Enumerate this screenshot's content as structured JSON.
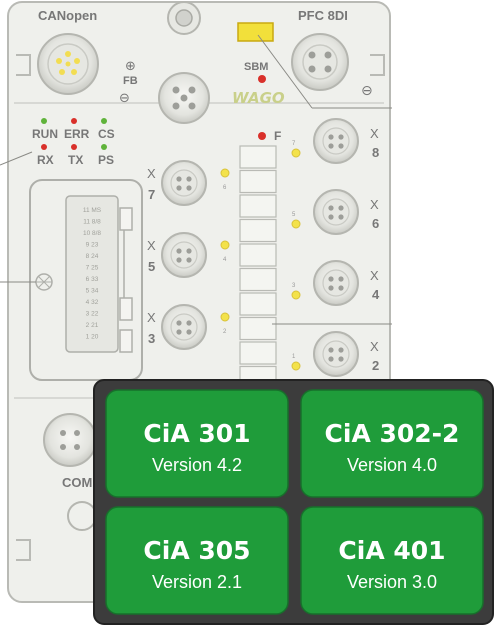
{
  "device": {
    "left_top_label": "CANopen",
    "right_top_label": "PFC 8DI",
    "fb_label": "FB",
    "sbm_label": "SBM",
    "brand": "WAGO",
    "f_label": "F",
    "leds": {
      "run": "RUN",
      "err": "ERR",
      "cs": "CS",
      "rx": "RX",
      "tx": "TX",
      "ps": "PS"
    },
    "ports_left": [
      {
        "x": "X",
        "n": "7",
        "led": "6"
      },
      {
        "x": "X",
        "n": "5",
        "led": "4"
      },
      {
        "x": "X",
        "n": "3",
        "led": "2"
      }
    ],
    "ports_right": [
      {
        "x": "X",
        "n": "8",
        "led": "7"
      },
      {
        "x": "X",
        "n": "6",
        "led": "5"
      },
      {
        "x": "X",
        "n": "4",
        "led": "3"
      },
      {
        "x": "X",
        "n": "2",
        "led": "1"
      }
    ],
    "com_label": "COM",
    "slot_rows": [
      "11 MS",
      "11 8/8",
      "10 8/8",
      "9 23",
      "8 24",
      "7 25",
      "6 33",
      "5 34",
      "4 32",
      "3 22",
      "2 21",
      "1 20"
    ]
  },
  "badges": [
    {
      "title": "CiA 301",
      "version": "Version 4.2"
    },
    {
      "title": "CiA 302-2",
      "version": "Version 4.0"
    },
    {
      "title": "CiA 305",
      "version": "Version 2.1"
    },
    {
      "title": "CiA 401",
      "version": "Version 3.0"
    }
  ],
  "colors": {
    "device_fill": "#eff0ec",
    "device_stroke": "#b9bab5",
    "led_red": "#d9302a",
    "led_green": "#5fb33a",
    "led_yellow": "#f3e24a",
    "badge_panel": "#3c3c3c",
    "badge_green": "#1f9c3a"
  }
}
